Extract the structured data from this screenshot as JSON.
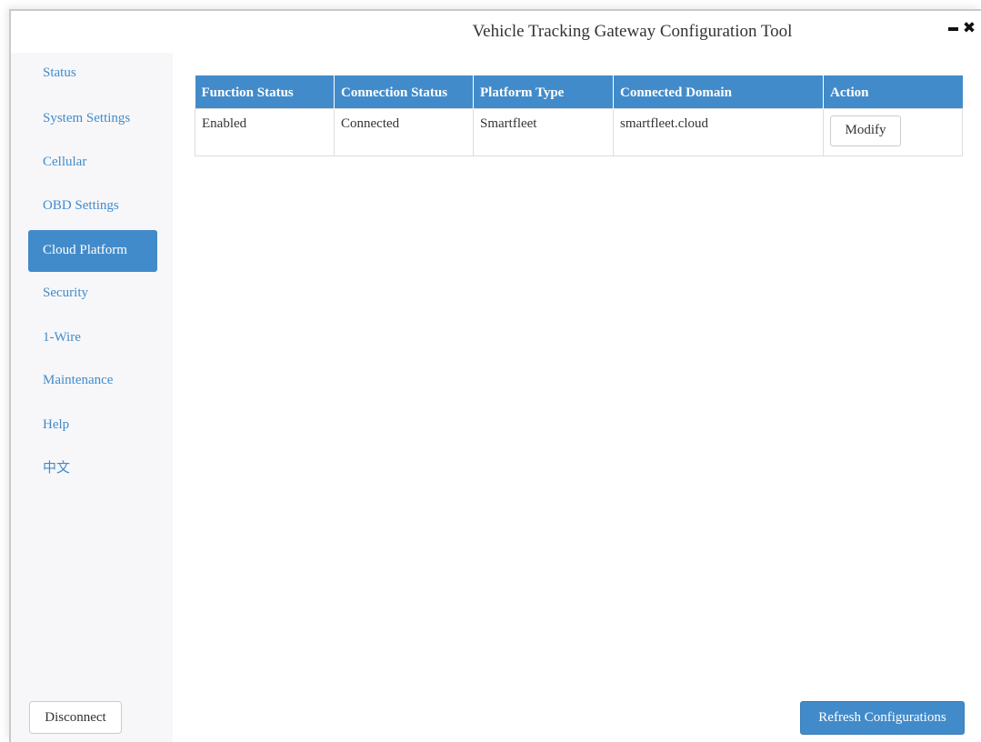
{
  "window": {
    "title": "Vehicle Tracking Gateway Configuration Tool",
    "minimize_icon": "minimize-icon",
    "close_icon": "close-icon"
  },
  "sidebar": {
    "items": [
      {
        "label": "Status",
        "active": false
      },
      {
        "label": "System Settings",
        "active": false
      },
      {
        "label": "Cellular",
        "active": false
      },
      {
        "label": "OBD Settings",
        "active": false
      },
      {
        "label": "Cloud Platform",
        "active": true
      },
      {
        "label": "Security",
        "active": false
      },
      {
        "label": "1-Wire",
        "active": false
      },
      {
        "label": "Maintenance",
        "active": false
      },
      {
        "label": "Help",
        "active": false
      },
      {
        "label": "中文",
        "active": false
      }
    ],
    "disconnect_label": "Disconnect"
  },
  "table": {
    "headers": [
      "Function Status",
      "Connection Status",
      "Platform Type",
      "Connected Domain",
      "Action"
    ],
    "rows": [
      {
        "function_status": "Enabled",
        "connection_status": "Connected",
        "platform_type": "Smartfleet",
        "connected_domain": "smartfleet.cloud",
        "action_label": "Modify"
      }
    ]
  },
  "footer": {
    "refresh_label": "Refresh Configurations"
  },
  "colors": {
    "accent": "#428bca",
    "sidebar_bg": "#f7f7f9",
    "text": "#333333"
  }
}
